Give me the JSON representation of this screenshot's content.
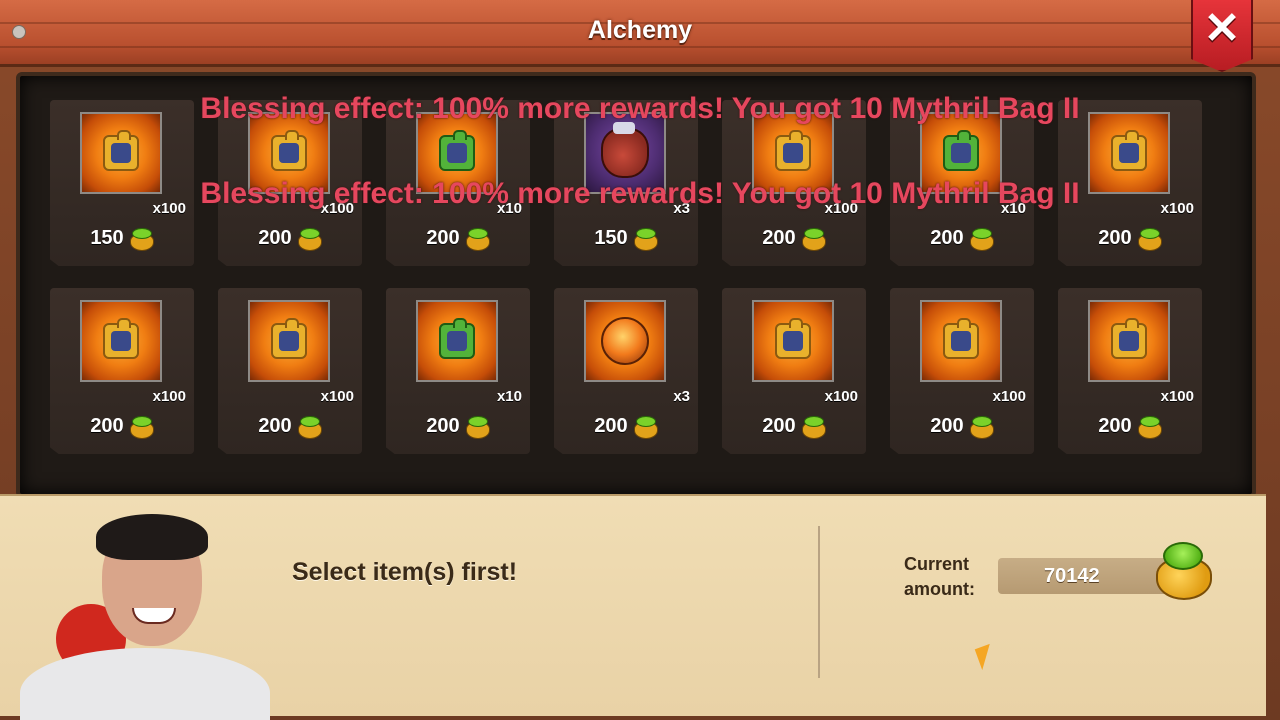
{
  "window": {
    "title": "Alchemy",
    "close_label": "✕"
  },
  "messages": [
    "Blessing effect: 100% more rewards! You got 10 Mythril Bag II",
    "Blessing effect: 100% more rewards! You got 10 Mythril Bag II"
  ],
  "rows": [
    [
      {
        "icon": "hero-shard-icon",
        "count": "x100",
        "price": "150"
      },
      {
        "icon": "hero-shard-icon",
        "count": "x100",
        "price": "200"
      },
      {
        "icon": "gear-shard-icon",
        "count": "x10",
        "price": "200"
      },
      {
        "icon": "mythril-bag-icon",
        "count": "x3",
        "price": "150"
      },
      {
        "icon": "hero-shard-icon",
        "count": "x100",
        "price": "200"
      },
      {
        "icon": "gear-shard-icon",
        "count": "x10",
        "price": "200"
      },
      {
        "icon": "hero-shard-icon",
        "count": "x100",
        "price": "200"
      }
    ],
    [
      {
        "icon": "hero-shard-icon",
        "count": "x100",
        "price": "200"
      },
      {
        "icon": "hero-shard-icon",
        "count": "x100",
        "price": "200"
      },
      {
        "icon": "gear-shard-icon",
        "count": "x10",
        "price": "200"
      },
      {
        "icon": "fire-orb-icon",
        "count": "x3",
        "price": "200"
      },
      {
        "icon": "hero-shard-icon",
        "count": "x100",
        "price": "200"
      },
      {
        "icon": "hero-shard-icon",
        "count": "x100",
        "price": "200"
      },
      {
        "icon": "hero-shard-icon",
        "count": "x100",
        "price": "200"
      }
    ]
  ],
  "footer": {
    "select_message": "Select item(s) first!",
    "amount_label": "Current amount:",
    "amount_value": "70142"
  },
  "colors": {
    "accent_red": "#e6475e",
    "title_bar": "#c55a36",
    "parchment": "#efdbb1"
  }
}
